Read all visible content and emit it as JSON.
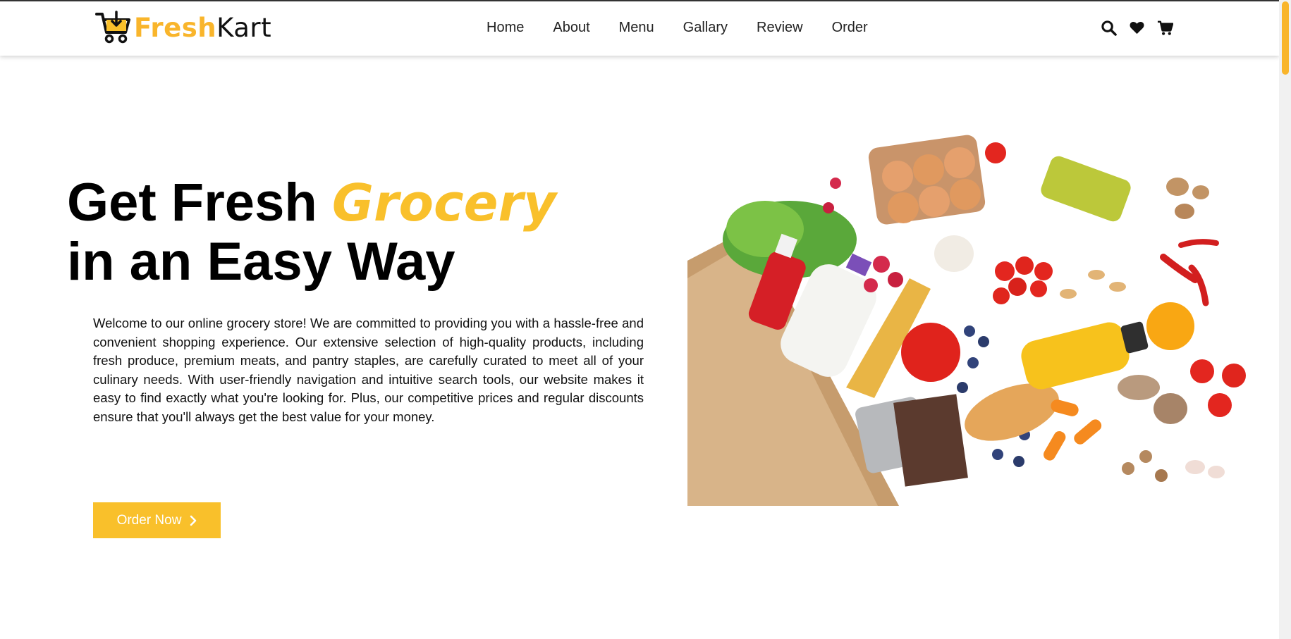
{
  "brand": {
    "name_part1": "Fresh",
    "name_part2": "Kart",
    "accent_color": "#f9c02b"
  },
  "nav": {
    "links": [
      {
        "label": "Home"
      },
      {
        "label": "About"
      },
      {
        "label": "Menu"
      },
      {
        "label": "Gallary"
      },
      {
        "label": "Review"
      },
      {
        "label": "Order"
      }
    ],
    "icons": [
      "search-icon",
      "heart-icon",
      "cart-icon"
    ]
  },
  "hero": {
    "title_part1": "Get Fresh ",
    "title_accent": "Grocery",
    "title_line2": "in an Easy Way",
    "description": "Welcome to our online grocery store! We are committed to providing you with a hassle-free and convenient shopping experience. Our extensive selection of high-quality products, including fresh produce, premium meats, and pantry staples, are carefully curated to meet all of your culinary needs. With user-friendly navigation and intuitive search tools, our website makes it easy to find exactly what you're looking for. Plus, our competitive prices and regular discounts ensure that you'll always get the best value for your money.",
    "cta_label": "Order Now"
  }
}
